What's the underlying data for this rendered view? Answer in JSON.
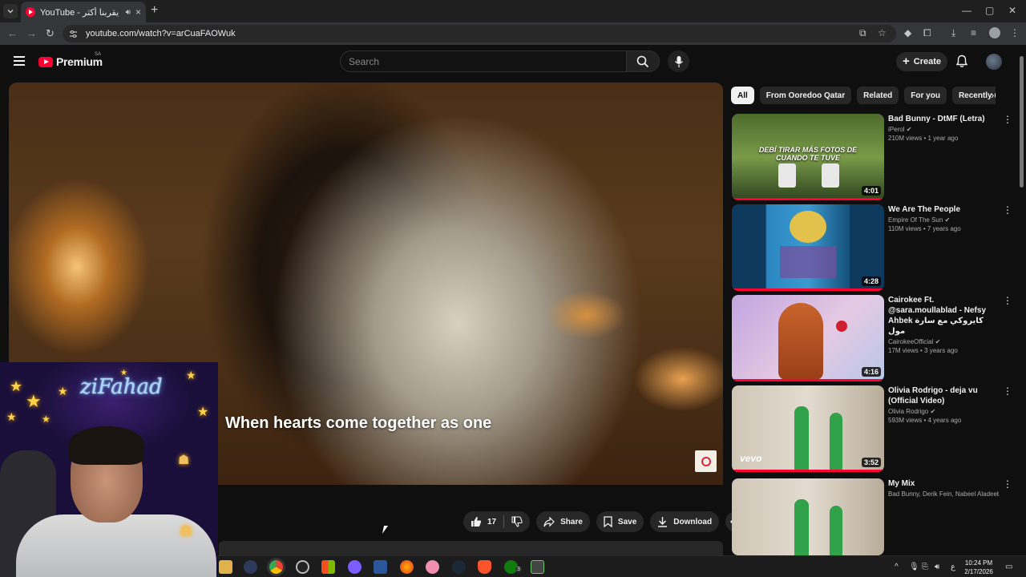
{
  "browser": {
    "tab_title": "YouTube - رمضان يقربنا أكثر",
    "tab_close": "×",
    "new_tab": "+",
    "url": "youtube.com/watch?v=arCuaFAOWuk",
    "window_controls": [
      "—",
      "▢",
      "✕"
    ]
  },
  "masthead": {
    "logo_text": "Premium",
    "logo_country": "SA",
    "search_placeholder": "Search",
    "create_label": "Create"
  },
  "player": {
    "subtitle": "When hearts come together as one"
  },
  "webcam": {
    "overlay_name": "ziFahad"
  },
  "actions": {
    "like_count": "17",
    "share_label": "Share",
    "save_label": "Save",
    "download_label": "Download"
  },
  "chips": [
    {
      "label": "All",
      "active": true
    },
    {
      "label": "From Ooredoo Qatar",
      "active": false
    },
    {
      "label": "Related",
      "active": false
    },
    {
      "label": "For you",
      "active": false
    },
    {
      "label": "Recently uplo",
      "active": false
    }
  ],
  "recommendations": [
    {
      "title": "Bad Bunny - DtMF (Letra)",
      "channel": "iPerol",
      "meta": "210M views • 1 year ago",
      "duration": "4:01",
      "thumb_text": "DEBÍ TIRAR MÁS FOTOS DE CUANDO TE TUVE",
      "thumb_colors": [
        "#3f5a2a",
        "#6e8a3c",
        "#2c3e1c"
      ]
    },
    {
      "title": "We Are The People",
      "channel": "Empire Of The Sun",
      "meta": "110M views • 7 years ago",
      "duration": "4:28",
      "thumb_text": "",
      "thumb_colors": [
        "#1e6a9a",
        "#e2c24a",
        "#0c2a4a"
      ]
    },
    {
      "title": "Cairokee Ft. @sara.moullablad - Nefsy Ahbek كايروكي مع سارة مول",
      "channel": "CairokeeOfficial",
      "meta": "17M views • 3 years ago",
      "duration": "4:16",
      "thumb_text": "",
      "thumb_colors": [
        "#c7a8d8",
        "#b0502a",
        "#e6c9e3"
      ]
    },
    {
      "title": "Olivia Rodrigo - deja vu (Official Video)",
      "channel": "Olivia Rodrigo",
      "meta": "593M views • 4 years ago",
      "duration": "3:52",
      "thumb_text": "vevo",
      "thumb_colors": [
        "#d9d2c4",
        "#2fa24a",
        "#a89a86"
      ]
    },
    {
      "title": "My Mix",
      "channel": "Bad Bunny, Derik Fein, Nabeel Aladeeb, a...",
      "meta": "",
      "duration": "",
      "thumb_text": "",
      "thumb_colors": [
        "#d9d2c4",
        "#2fa24a",
        "#a89a86"
      ]
    }
  ],
  "taskbar": {
    "clock_time": "10:24 PM",
    "clock_date": "2/17/2026",
    "lang": "ع",
    "xbox_badge": "3"
  }
}
